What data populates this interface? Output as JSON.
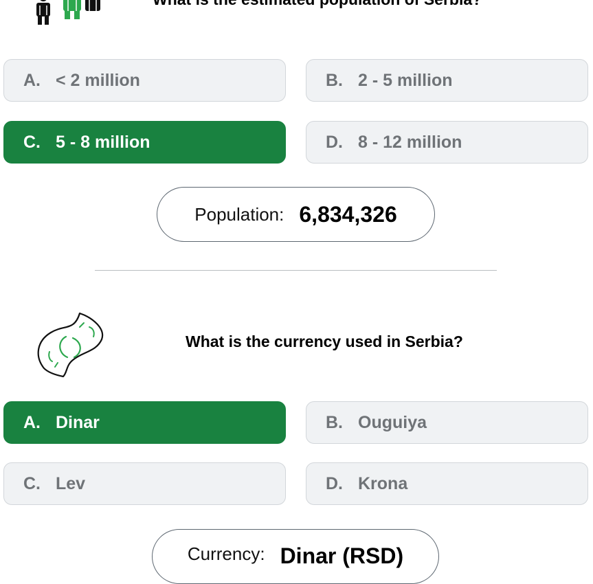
{
  "quiz": [
    {
      "question": "What is the estimated population of Serbia?",
      "icon": "people-icon",
      "options": [
        {
          "letter": "A.",
          "text": "< 2 million",
          "selected": false
        },
        {
          "letter": "B.",
          "text": "2 - 5 million",
          "selected": false
        },
        {
          "letter": "C.",
          "text": "5 - 8 million",
          "selected": true
        },
        {
          "letter": "D.",
          "text": "8 - 12 million",
          "selected": false
        }
      ],
      "result": {
        "label": "Population:",
        "value": "6,834,326"
      }
    },
    {
      "question": "What is the currency used in Serbia?",
      "icon": "banknote-icon",
      "options": [
        {
          "letter": "A.",
          "text": "Dinar",
          "selected": true
        },
        {
          "letter": "B.",
          "text": "Ouguiya",
          "selected": false
        },
        {
          "letter": "C.",
          "text": "Lev",
          "selected": false
        },
        {
          "letter": "D.",
          "text": "Krona",
          "selected": false
        }
      ],
      "result": {
        "label": "Currency:",
        "value": "Dinar (RSD)"
      }
    }
  ],
  "colors": {
    "selected": "#198240",
    "option_bg": "#f0f2f4",
    "option_text": "#6f7377",
    "icon_green": "#2da84e"
  }
}
